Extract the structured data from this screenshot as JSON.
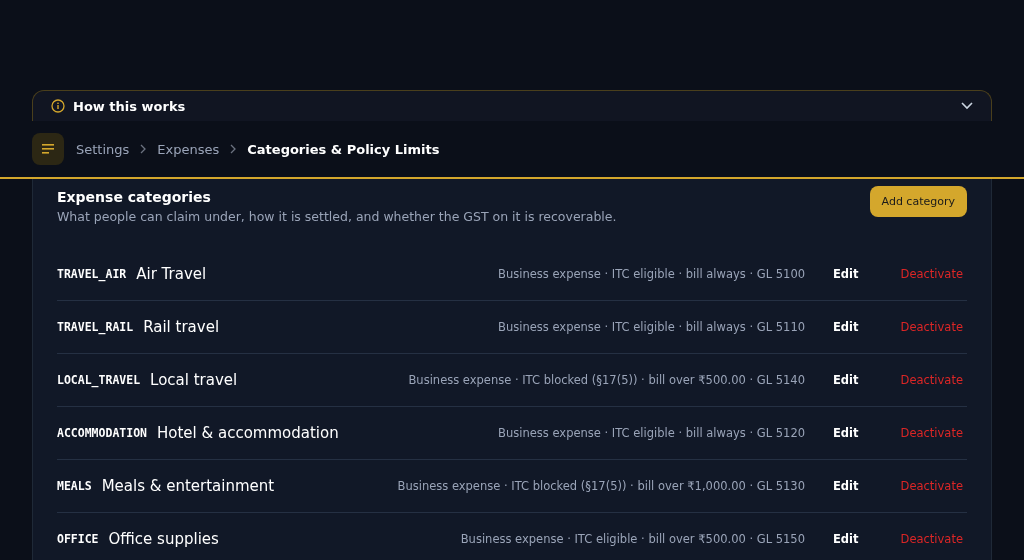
{
  "info_panel": {
    "title": "How this works",
    "expanded": false
  },
  "breadcrumb": [
    {
      "label": "Settings",
      "current": false
    },
    {
      "label": "Expenses",
      "current": false
    },
    {
      "label": "Categories & Policy Limits",
      "current": true
    }
  ],
  "section": {
    "title": "Expense categories",
    "subtitle": "What people can claim under, how it is settled, and whether the GST on it is recoverable.",
    "add_button": "Add category"
  },
  "categories": [
    {
      "code": "TRAVEL_AIR",
      "name": "Air Travel",
      "details": "Business expense · ITC eligible · bill always · GL 5100",
      "edit": "Edit",
      "deactivate": "Deactivate"
    },
    {
      "code": "TRAVEL_RAIL",
      "name": "Rail travel",
      "details": "Business expense · ITC eligible · bill always · GL 5110",
      "edit": "Edit",
      "deactivate": "Deactivate"
    },
    {
      "code": "LOCAL_TRAVEL",
      "name": "Local travel",
      "details": "Business expense · ITC blocked (§17(5)) · bill over ₹500.00 · GL 5140",
      "edit": "Edit",
      "deactivate": "Deactivate"
    },
    {
      "code": "ACCOMMODATION",
      "name": "Hotel & accommodation",
      "details": "Business expense · ITC eligible · bill always · GL 5120",
      "edit": "Edit",
      "deactivate": "Deactivate"
    },
    {
      "code": "MEALS",
      "name": "Meals & entertainment",
      "details": "Business expense · ITC blocked (§17(5)) · bill over ₹1,000.00 · GL 5130",
      "edit": "Edit",
      "deactivate": "Deactivate"
    },
    {
      "code": "OFFICE",
      "name": "Office supplies",
      "details": "Business expense · ITC eligible · bill over ₹500.00 · GL 5150",
      "edit": "Edit",
      "deactivate": "Deactivate"
    }
  ]
}
